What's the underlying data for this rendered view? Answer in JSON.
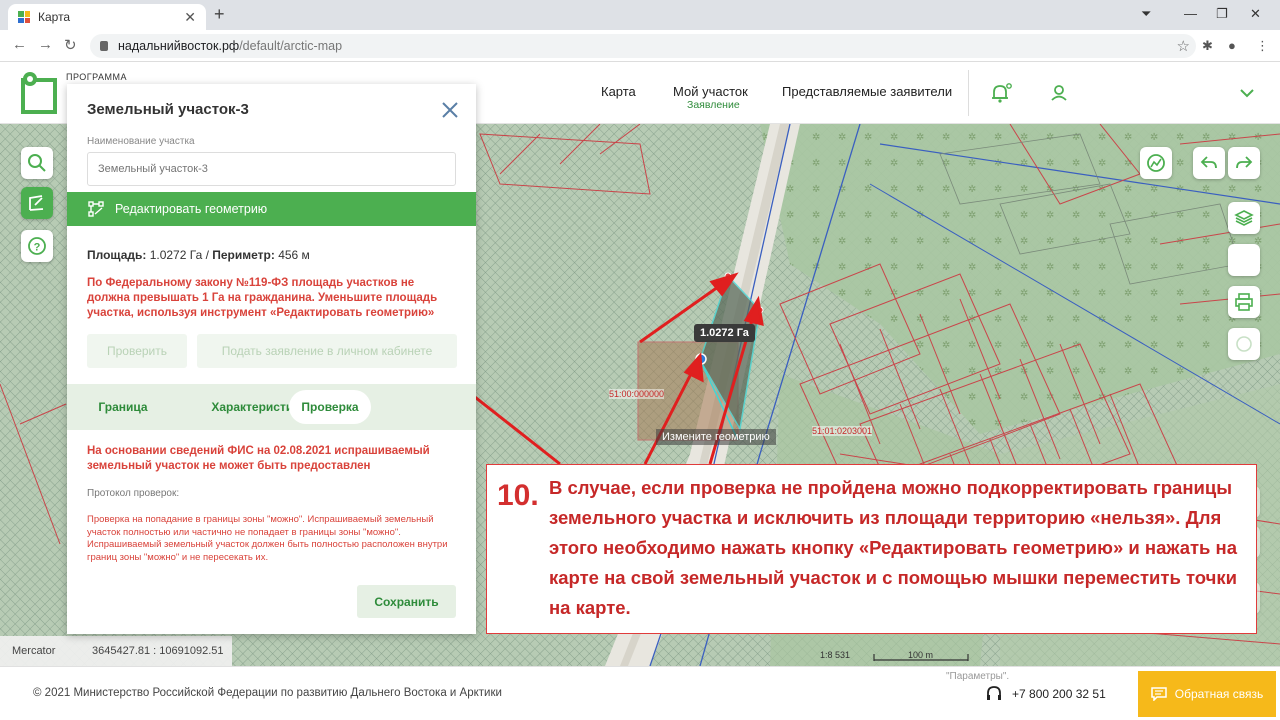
{
  "browser": {
    "tab_title": "Карта",
    "url_host": "надальнийвосток.рф",
    "url_path": "/default/arctic-map"
  },
  "header": {
    "logo_text": "ПРОГРАММА",
    "nav": [
      {
        "label": "Карта"
      },
      {
        "label": "Мой участок",
        "sub": "Заявление"
      },
      {
        "label": "Представляемые заявители"
      }
    ]
  },
  "panel": {
    "title": "Земельный участок-3",
    "name_label": "Наименование участка",
    "name_placeholder": "Земельный участок-3",
    "edit_geometry": "Редактировать геометрию",
    "area_label": "Площадь:",
    "area_value": "1.0272 Га /",
    "perimeter_label": "Периметр:",
    "perimeter_value": "456 м",
    "warning": "По Федеральному закону №119-ФЗ площадь участков не должна превышать 1 Га на гражданина. Уменьшите площадь участка, используя инструмент «Редактировать геометрию»",
    "check_button": "Проверить",
    "submit_button": "Подать заявление в личном кабинете",
    "tabs": [
      {
        "label": "Граница"
      },
      {
        "label": "Характеристики"
      },
      {
        "label": "Проверка"
      }
    ],
    "result": "На основании сведений ФИС на 02.08.2021 испрашиваемый земельный участок не может быть предоставлен",
    "protocol_label": "Протокол проверок:",
    "protocol_text": "Проверка на попадание в границы зоны \"можно\". Испрашиваемый земельный участок полностью или частично не попадает в границы зоны \"можно\". Испрашиваемый земельный участок должен быть полностью расположен внутри границ зоны \"можно\" и не пересекать их.",
    "save_button": "Сохранить"
  },
  "map": {
    "parcel_label_1": "51:00:000000",
    "parcel_label_2": "51:01:0203001",
    "area_tooltip": "1.0272 Га",
    "edit_hint": "Измените геометрию",
    "projection": "Mercator",
    "coordinates": "3645427.81 : 10691092.51",
    "scale_ratio": "1:8 531",
    "scale_bar": "100 m"
  },
  "callout": {
    "number": "10.",
    "text": "В случае, если проверка не пройдена можно подкорректировать границы земельного участка и исключить из площади территорию «нельзя». Для этого необходимо нажать кнопку «Редактировать геометрию» и нажать на карте на свой земельный участок и с помощью мышки переместить точки на карте."
  },
  "footer": {
    "copyright": "© 2021 Министерство Российской Федерации по развитию Дальнего Востока и Арктики",
    "params": "\"Параметры\".",
    "phone": "+7 800 200 32 51",
    "feedback": "Обратная связь"
  },
  "colors": {
    "brand_green": "#4caf50",
    "warning_red": "#d9433b",
    "feedback_yellow": "#f6b91a"
  }
}
